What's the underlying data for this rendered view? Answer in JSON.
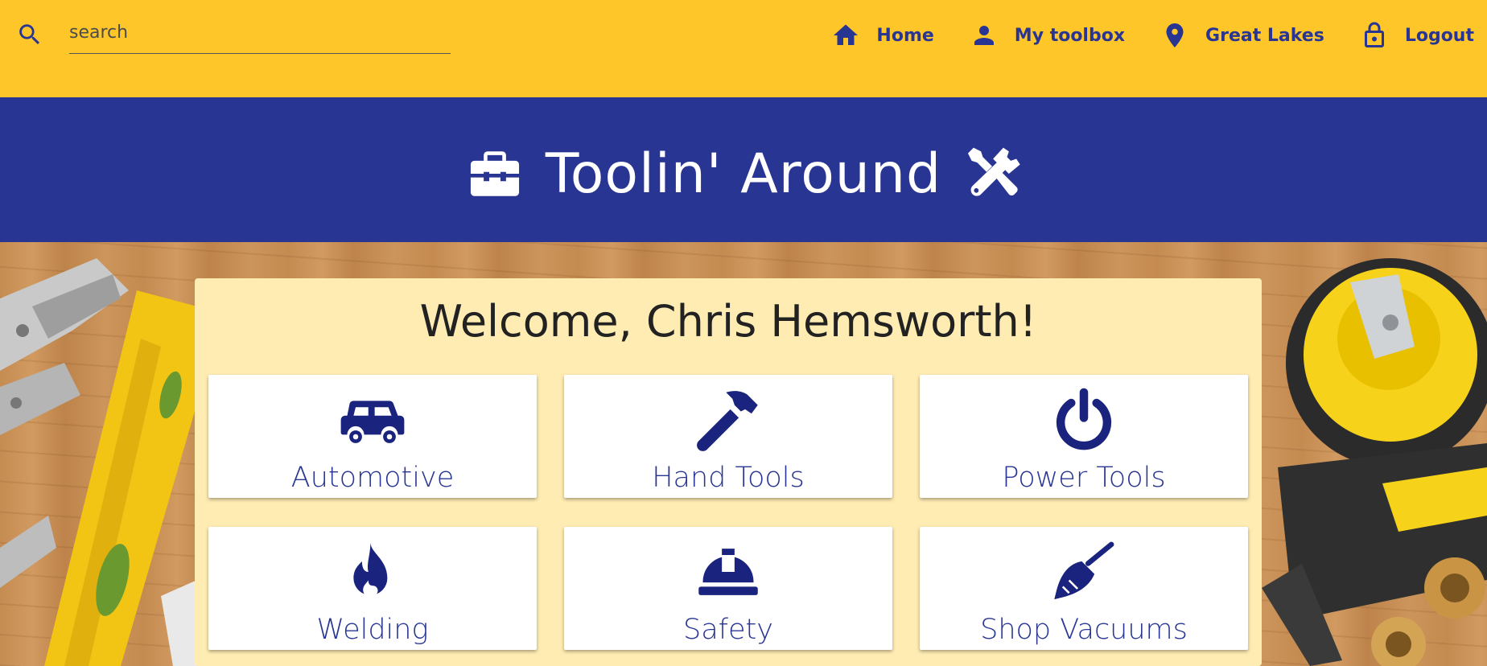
{
  "search": {
    "placeholder": "search"
  },
  "nav": {
    "home": "Home",
    "toolbox": "My toolbox",
    "location": "Great Lakes",
    "logout": "Logout"
  },
  "header": {
    "title": "Toolin' Around"
  },
  "welcome": {
    "text": "Welcome, Chris Hemsworth!"
  },
  "categories": [
    {
      "label": "Automotive",
      "icon": "car-icon"
    },
    {
      "label": "Hand Tools",
      "icon": "hammer-icon"
    },
    {
      "label": "Power Tools",
      "icon": "power-icon"
    },
    {
      "label": "Welding",
      "icon": "flame-icon"
    },
    {
      "label": "Safety",
      "icon": "hard-hat-icon"
    },
    {
      "label": "Shop Vacuums",
      "icon": "broom-icon"
    }
  ],
  "colors": {
    "topbar": "#ffc629",
    "header": "#283593",
    "panel": "#ffecb3",
    "accent": "#283593"
  }
}
